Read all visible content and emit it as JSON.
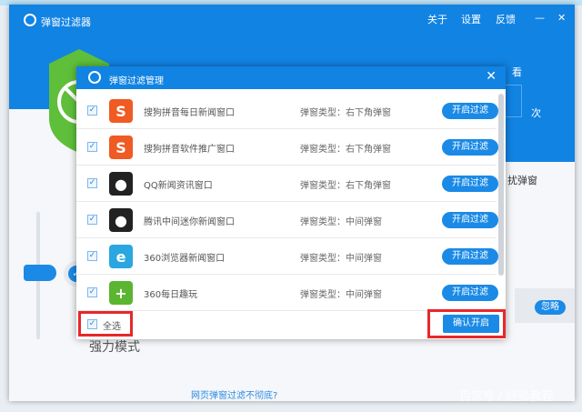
{
  "main_window": {
    "title": "弹窗过滤器",
    "nav": [
      "关于",
      "设置",
      "反馈"
    ],
    "minimize": "—",
    "close": "✕",
    "behind_texts": {
      "watch": "看",
      "times": "次",
      "harass_popup": "扰弹窗",
      "ignore_button": "忽略",
      "strong_mode": "强力模式",
      "feedback_link": "网页弹窗过滤不彻底?"
    }
  },
  "dialog": {
    "title": "弹窗过滤管理",
    "close": "✕",
    "items": [
      {
        "name": "搜狗拼音每日新闻窗口",
        "type": "弹窗类型：右下角弹窗",
        "button": "开启过滤",
        "checked": true,
        "icon": "sogou-icon",
        "color": "#f05a23"
      },
      {
        "name": "搜狗拼音软件推广窗口",
        "type": "弹窗类型：右下角弹窗",
        "button": "开启过滤",
        "checked": true,
        "icon": "sogou-icon",
        "color": "#f05a23"
      },
      {
        "name": "QQ新闻资讯窗口",
        "type": "弹窗类型：右下角弹窗",
        "button": "开启过滤",
        "checked": true,
        "icon": "qq-penguin-icon",
        "color": "#222222"
      },
      {
        "name": "腾讯中间迷你新闻窗口",
        "type": "弹窗类型：中间弹窗",
        "button": "开启过滤",
        "checked": true,
        "icon": "qq-penguin-icon",
        "color": "#222222"
      },
      {
        "name": "360浏览器新闻窗口",
        "type": "弹窗类型：中间弹窗",
        "button": "开启过滤",
        "checked": true,
        "icon": "360-browser-icon",
        "color": "#2aa7e0"
      },
      {
        "name": "360每日趣玩",
        "type": "弹窗类型：中间弹窗",
        "button": "开启过滤",
        "checked": true,
        "icon": "360-plus-icon",
        "color": "#5cb531"
      }
    ],
    "select_all": "全选",
    "confirm": "确认开启"
  },
  "watermark": "百家号 / 经验教程"
}
